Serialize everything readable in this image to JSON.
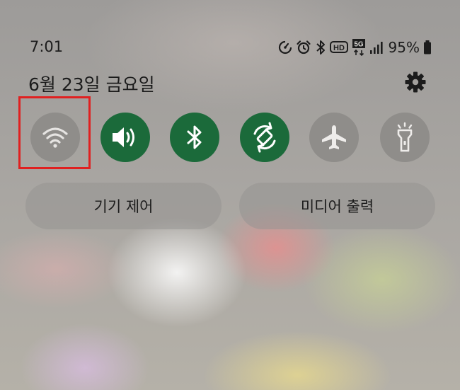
{
  "status_bar": {
    "time": "7:01",
    "icons": [
      "data-saver-icon",
      "alarm-icon",
      "bluetooth-icon",
      "hd-voice-icon",
      "5g-icon",
      "signal-icon"
    ],
    "hd_label": "HD",
    "network_label": "5G",
    "battery_percent": "95%"
  },
  "header": {
    "date": "6월 23일 금요일",
    "settings_icon": "gear-icon"
  },
  "quick_tiles": [
    {
      "name": "wifi",
      "icon": "wifi-icon",
      "state": "off",
      "highlighted": true
    },
    {
      "name": "sound",
      "icon": "speaker-icon",
      "state": "on"
    },
    {
      "name": "bluetooth",
      "icon": "bluetooth-icon",
      "state": "on"
    },
    {
      "name": "auto-rotate",
      "icon": "rotate-icon",
      "state": "on"
    },
    {
      "name": "airplane-mode",
      "icon": "airplane-icon",
      "state": "off"
    },
    {
      "name": "flashlight",
      "icon": "flashlight-icon",
      "state": "off"
    }
  ],
  "buttons": {
    "device_control": "기기 제어",
    "media_output": "미디어 출력"
  },
  "colors": {
    "tile_on": "#1b6a3a",
    "tile_off": "#8f8d8a",
    "highlight": "#e02020"
  }
}
